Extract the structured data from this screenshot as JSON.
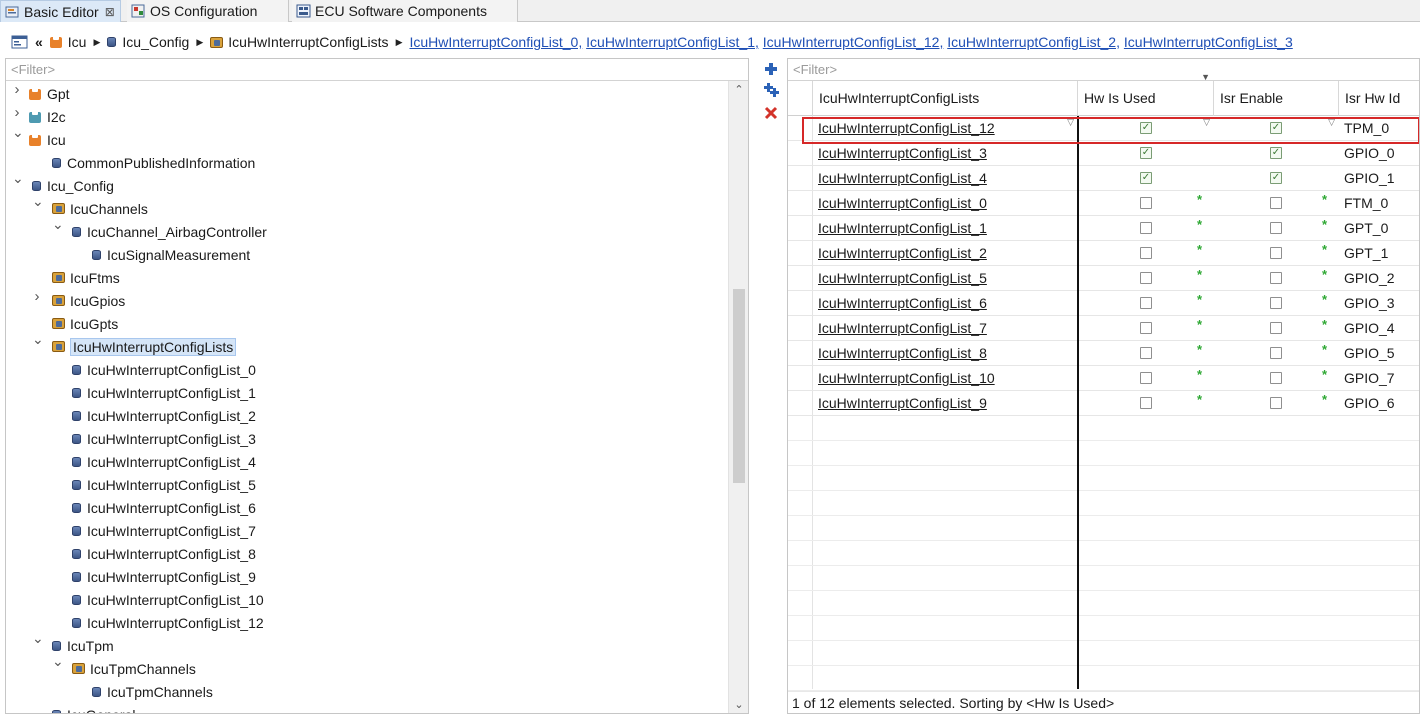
{
  "tabs": [
    {
      "label": "Basic Editor",
      "active": true,
      "close": "⊠",
      "icon": "basic-editor-icon"
    },
    {
      "label": "OS Configuration",
      "active": false,
      "icon": "os-configuration-icon"
    },
    {
      "label": "ECU Software Components",
      "active": false,
      "icon": "ecu-components-icon"
    }
  ],
  "breadcrumb": {
    "back": "«",
    "items": [
      "Icu",
      "Icu_Config",
      "IcuHwInterruptConfigLists"
    ],
    "links": [
      "IcuHwInterruptConfigList_0,",
      "IcuHwInterruptConfigList_1,",
      "IcuHwInterruptConfigList_12,",
      "IcuHwInterruptConfigList_2,",
      "IcuHwInterruptConfigList_3"
    ]
  },
  "tree": {
    "filter_placeholder": "<Filter>",
    "nodes": [
      {
        "label": "Gpt",
        "icon": "module-icon",
        "expander": "collapsed"
      },
      {
        "label": "I2c",
        "icon": "module-icon",
        "expander": "collapsed"
      },
      {
        "label": "Icu",
        "icon": "module-icon",
        "expander": "expanded"
      },
      {
        "label": "CommonPublishedInformation",
        "icon": "container-icon",
        "expander": "none"
      },
      {
        "label": "Icu_Config",
        "icon": "container-icon",
        "expander": "expanded"
      },
      {
        "label": "IcuChannels",
        "icon": "list-icon",
        "expander": "expanded"
      },
      {
        "label": "IcuChannel_AirbagController",
        "icon": "container-icon",
        "expander": "expanded"
      },
      {
        "label": "IcuSignalMeasurement",
        "icon": "container-icon",
        "expander": "none"
      },
      {
        "label": "IcuFtms",
        "icon": "list-icon",
        "expander": "none"
      },
      {
        "label": "IcuGpios",
        "icon": "list-icon",
        "expander": "collapsed"
      },
      {
        "label": "IcuGpts",
        "icon": "list-icon",
        "expander": "none"
      },
      {
        "label": "IcuHwInterruptConfigLists",
        "icon": "list-icon",
        "expander": "expanded",
        "selected": true
      },
      {
        "label": "IcuHwInterruptConfigList_0",
        "icon": "container-icon",
        "expander": "none"
      },
      {
        "label": "IcuHwInterruptConfigList_1",
        "icon": "container-icon",
        "expander": "none"
      },
      {
        "label": "IcuHwInterruptConfigList_2",
        "icon": "container-icon",
        "expander": "none"
      },
      {
        "label": "IcuHwInterruptConfigList_3",
        "icon": "container-icon",
        "expander": "none"
      },
      {
        "label": "IcuHwInterruptConfigList_4",
        "icon": "container-icon",
        "expander": "none"
      },
      {
        "label": "IcuHwInterruptConfigList_5",
        "icon": "container-icon",
        "expander": "none"
      },
      {
        "label": "IcuHwInterruptConfigList_6",
        "icon": "container-icon",
        "expander": "none"
      },
      {
        "label": "IcuHwInterruptConfigList_7",
        "icon": "container-icon",
        "expander": "none"
      },
      {
        "label": "IcuHwInterruptConfigList_8",
        "icon": "container-icon",
        "expander": "none"
      },
      {
        "label": "IcuHwInterruptConfigList_9",
        "icon": "container-icon",
        "expander": "none"
      },
      {
        "label": "IcuHwInterruptConfigList_10",
        "icon": "container-icon",
        "expander": "none"
      },
      {
        "label": "IcuHwInterruptConfigList_12",
        "icon": "container-icon",
        "expander": "none"
      },
      {
        "label": "IcuTpm",
        "icon": "container-icon",
        "expander": "expanded"
      },
      {
        "label": "IcuTpmChannels",
        "icon": "list-icon",
        "expander": "expanded"
      },
      {
        "label": "IcuTpmChannels",
        "icon": "container-icon",
        "expander": "none"
      },
      {
        "label": "IcuGeneral",
        "icon": "container-icon",
        "expander": "none"
      }
    ]
  },
  "toolbar": {
    "add": "add-icon",
    "add_multiple": "add-multiple-icon",
    "delete": "delete-icon"
  },
  "table": {
    "filter_placeholder": "<Filter>",
    "columns": [
      "IcuHwInterruptConfigLists",
      "Hw Is Used",
      "Isr Enable",
      "Isr Hw Id"
    ],
    "rows": [
      {
        "name": "IcuHwInterruptConfigList_12",
        "hw_is_used": true,
        "isr_enable": true,
        "isr_hw_id": "TPM_0",
        "default_mark": ""
      },
      {
        "name": "IcuHwInterruptConfigList_3",
        "hw_is_used": true,
        "isr_enable": true,
        "isr_hw_id": "GPIO_0",
        "default_mark": ""
      },
      {
        "name": "IcuHwInterruptConfigList_4",
        "hw_is_used": true,
        "isr_enable": true,
        "isr_hw_id": "GPIO_1",
        "default_mark": ""
      },
      {
        "name": "IcuHwInterruptConfigList_0",
        "hw_is_used": false,
        "isr_enable": false,
        "isr_hw_id": "FTM_0",
        "default_mark": "*"
      },
      {
        "name": "IcuHwInterruptConfigList_1",
        "hw_is_used": false,
        "isr_enable": false,
        "isr_hw_id": "GPT_0",
        "default_mark": "*"
      },
      {
        "name": "IcuHwInterruptConfigList_2",
        "hw_is_used": false,
        "isr_enable": false,
        "isr_hw_id": "GPT_1",
        "default_mark": "*"
      },
      {
        "name": "IcuHwInterruptConfigList_5",
        "hw_is_used": false,
        "isr_enable": false,
        "isr_hw_id": "GPIO_2",
        "default_mark": "*"
      },
      {
        "name": "IcuHwInterruptConfigList_6",
        "hw_is_used": false,
        "isr_enable": false,
        "isr_hw_id": "GPIO_3",
        "default_mark": "*"
      },
      {
        "name": "IcuHwInterruptConfigList_7",
        "hw_is_used": false,
        "isr_enable": false,
        "isr_hw_id": "GPIO_4",
        "default_mark": "*"
      },
      {
        "name": "IcuHwInterruptConfigList_8",
        "hw_is_used": false,
        "isr_enable": false,
        "isr_hw_id": "GPIO_5",
        "default_mark": "*"
      },
      {
        "name": "IcuHwInterruptConfigList_10",
        "hw_is_used": false,
        "isr_enable": false,
        "isr_hw_id": "GPIO_7",
        "default_mark": "*"
      },
      {
        "name": "IcuHwInterruptConfigList_9",
        "hw_is_used": false,
        "isr_enable": false,
        "isr_hw_id": "GPIO_6",
        "default_mark": "*"
      }
    ],
    "highlighted_row": "IcuHwInterruptConfigList_12"
  },
  "status": "1 of 12 elements selected. Sorting by <Hw Is Used>",
  "colors": {
    "highlight_border": "#d62828",
    "selection_bg": "#d5e5f7",
    "checkmark": "#3d7a35",
    "default_star": "#2ea833"
  }
}
